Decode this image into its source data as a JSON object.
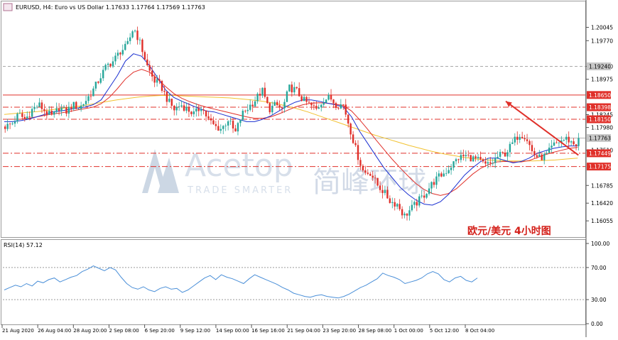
{
  "header": {
    "symbol_line": "EURUSD, H4:  Euro vs US Dollar  1.17633 1.17764 1.17569 1.17763"
  },
  "watermark": {
    "brand": "Acetop",
    "brand_cn": "简峰环球",
    "tagline": "TRADE SMARTER"
  },
  "annotation_cn": "欧元/美元  4小时图",
  "colors": {
    "bull": "#26a69a",
    "bear": "#e0302a",
    "ma_fast": "#1a2fd0",
    "ma_mid": "#e0302a",
    "ma_slow": "#f2c230",
    "level": "#e0302a",
    "rsi": "#4a8fd8",
    "arrow": "#e0302a",
    "current_price_bg": "#c8c8c8"
  },
  "chart_data": [
    {
      "type": "candlestick",
      "title": "EURUSD, H4: Euro vs US Dollar",
      "ohlc_last": {
        "open": 1.17633,
        "high": 1.17764,
        "low": 1.17569,
        "close": 1.17763
      },
      "ylim": [
        1.1575,
        1.2055
      ],
      "y_ticks": [
        "1.20045",
        "1.19770",
        "1.19240",
        "1.18975",
        "1.18245",
        "1.17980",
        "1.17510",
        "1.16785",
        "1.16420",
        "1.16055"
      ],
      "price_labels": [
        {
          "label": "1.19240",
          "value": 1.1924,
          "style": "current-high"
        },
        {
          "label": "1.18650",
          "value": 1.1865,
          "style": "level-solid"
        },
        {
          "label": "1.18398",
          "value": 1.18398,
          "style": "level-dash"
        },
        {
          "label": "1.18150",
          "value": 1.1815,
          "style": "level-dash"
        },
        {
          "label": "1.17763",
          "value": 1.17763,
          "style": "current"
        },
        {
          "label": "1.17449",
          "value": 1.17449,
          "style": "level-dash"
        },
        {
          "label": "1.17175",
          "value": 1.17175,
          "style": "level-dash"
        }
      ],
      "x_ticks": [
        "21 Aug 2020",
        "26 Aug 04:00",
        "28 Aug 20:00",
        "2 Sep 08:00",
        "6 Sep 20:00",
        "9 Sep 12:00",
        "14 Sep 00:00",
        "16 Sep 16:00",
        "21 Sep 04:00",
        "23 Sep 20:00",
        "28 Sep 08:00",
        "1 Oct 00:00",
        "5 Oct 12:00",
        "8 Oct 04:00"
      ],
      "close_path": [
        1.18,
        1.1805,
        1.1825,
        1.1815,
        1.1835,
        1.1845,
        1.183,
        1.182,
        1.184,
        1.183,
        1.1845,
        1.1838,
        1.1855,
        1.1875,
        1.19,
        1.1925,
        1.1935,
        1.1955,
        1.1965,
        1.2005,
        1.197,
        1.1925,
        1.1895,
        1.1885,
        1.1855,
        1.1835,
        1.1845,
        1.1835,
        1.1825,
        1.1842,
        1.1815,
        1.18,
        1.1795,
        1.1815,
        1.1785,
        1.1825,
        1.184,
        1.1855,
        1.1875,
        1.1835,
        1.1845,
        1.1835,
        1.188,
        1.1875,
        1.1855,
        1.1845,
        1.1835,
        1.1855,
        1.186,
        1.1845,
        1.1845,
        1.1795,
        1.1745,
        1.1705,
        1.1705,
        1.168,
        1.1665,
        1.1645,
        1.164,
        1.1615,
        1.163,
        1.1645,
        1.166,
        1.168,
        1.1695,
        1.1705,
        1.172,
        1.1735,
        1.174,
        1.1735,
        1.173,
        1.172,
        1.1725,
        1.174,
        1.1745,
        1.1765,
        1.1785,
        1.178,
        1.1745,
        1.1735,
        1.174,
        1.176,
        1.177,
        1.1775,
        1.1765,
        1.1763
      ],
      "ma_fast": [
        1.181,
        1.181,
        1.1812,
        1.1815,
        1.182,
        1.1825,
        1.183,
        1.1832,
        1.1835,
        1.1838,
        1.184,
        1.1845,
        1.1855,
        1.188,
        1.1905,
        1.1935,
        1.195,
        1.1945,
        1.1925,
        1.19,
        1.1875,
        1.186,
        1.1852,
        1.1845,
        1.1838,
        1.1832,
        1.183,
        1.1825,
        1.182,
        1.1815,
        1.181,
        1.181,
        1.1815,
        1.1822,
        1.1832,
        1.1842,
        1.185,
        1.1855,
        1.1855,
        1.1852,
        1.1848,
        1.1845,
        1.184,
        1.182,
        1.179,
        1.1765,
        1.174,
        1.1715,
        1.1695,
        1.1675,
        1.166,
        1.1648,
        1.164,
        1.1638,
        1.1645,
        1.166,
        1.168,
        1.17,
        1.1715,
        1.1728,
        1.1735,
        1.1735,
        1.173,
        1.1725,
        1.1728,
        1.1735,
        1.1745,
        1.175,
        1.1755,
        1.1758,
        1.176,
        1.176
      ],
      "ma_mid": [
        1.1815,
        1.1815,
        1.1815,
        1.1817,
        1.182,
        1.1823,
        1.1826,
        1.1828,
        1.1831,
        1.1834,
        1.1837,
        1.184,
        1.1847,
        1.186,
        1.1878,
        1.1898,
        1.1912,
        1.1918,
        1.1912,
        1.1898,
        1.1882,
        1.1868,
        1.1858,
        1.1851,
        1.1845,
        1.184,
        1.1836,
        1.1832,
        1.1828,
        1.1824,
        1.182,
        1.1817,
        1.1817,
        1.182,
        1.1826,
        1.1833,
        1.184,
        1.1845,
        1.1848,
        1.1849,
        1.1848,
        1.1846,
        1.1843,
        1.1832,
        1.1814,
        1.1794,
        1.1773,
        1.1753,
        1.1733,
        1.1715,
        1.1698,
        1.1682,
        1.167,
        1.1662,
        1.1658,
        1.1662,
        1.1672,
        1.1687,
        1.1702,
        1.1714,
        1.1722,
        1.1727,
        1.1728,
        1.1727,
        1.1727,
        1.173,
        1.1736,
        1.1742,
        1.1747,
        1.1751,
        1.1755,
        1.1757
      ],
      "ma_slow": [
        1.1825,
        1.1827,
        1.1829,
        1.1831,
        1.1834,
        1.1837,
        1.184,
        1.1843,
        1.1847,
        1.1851,
        1.1855,
        1.1858,
        1.1861,
        1.1863,
        1.1864,
        1.1864,
        1.1863,
        1.1862,
        1.1861,
        1.186,
        1.1859,
        1.1857,
        1.1855,
        1.1852,
        1.1848,
        1.1843,
        1.1837,
        1.183,
        1.1822,
        1.1814,
        1.1806,
        1.1798,
        1.179,
        1.1782,
        1.1775,
        1.1768,
        1.1761,
        1.1755,
        1.1749,
        1.1744,
        1.174,
        1.1736,
        1.1733,
        1.1731,
        1.173,
        1.1729,
        1.1729,
        1.1729,
        1.173,
        1.1731,
        1.1733,
        1.1735
      ],
      "forecast_arrow": "up from last bar toward 1.1855"
    },
    {
      "type": "line",
      "title": "RSI(14) 57.12",
      "value_last": 57.12,
      "ylim": [
        0,
        100
      ],
      "y_ticks": [
        "100.00",
        "70.00",
        "30.00",
        "0.00"
      ],
      "levels": [
        70,
        30
      ],
      "values": [
        42,
        45,
        48,
        46,
        50,
        47,
        53,
        51,
        55,
        57,
        52,
        55,
        58,
        60,
        65,
        68,
        72,
        69,
        66,
        70,
        67,
        58,
        50,
        45,
        43,
        46,
        42,
        40,
        44,
        46,
        43,
        44,
        39,
        42,
        47,
        52,
        57,
        60,
        55,
        61,
        58,
        56,
        53,
        50,
        56,
        61,
        58,
        55,
        52,
        49,
        45,
        42,
        38,
        36,
        34,
        33,
        35,
        36,
        34,
        33,
        32,
        34,
        37,
        41,
        45,
        48,
        52,
        56,
        63,
        60,
        58,
        55,
        50,
        52,
        54,
        57,
        62,
        65,
        62,
        55,
        52,
        57,
        59,
        54,
        52,
        57
      ]
    }
  ]
}
